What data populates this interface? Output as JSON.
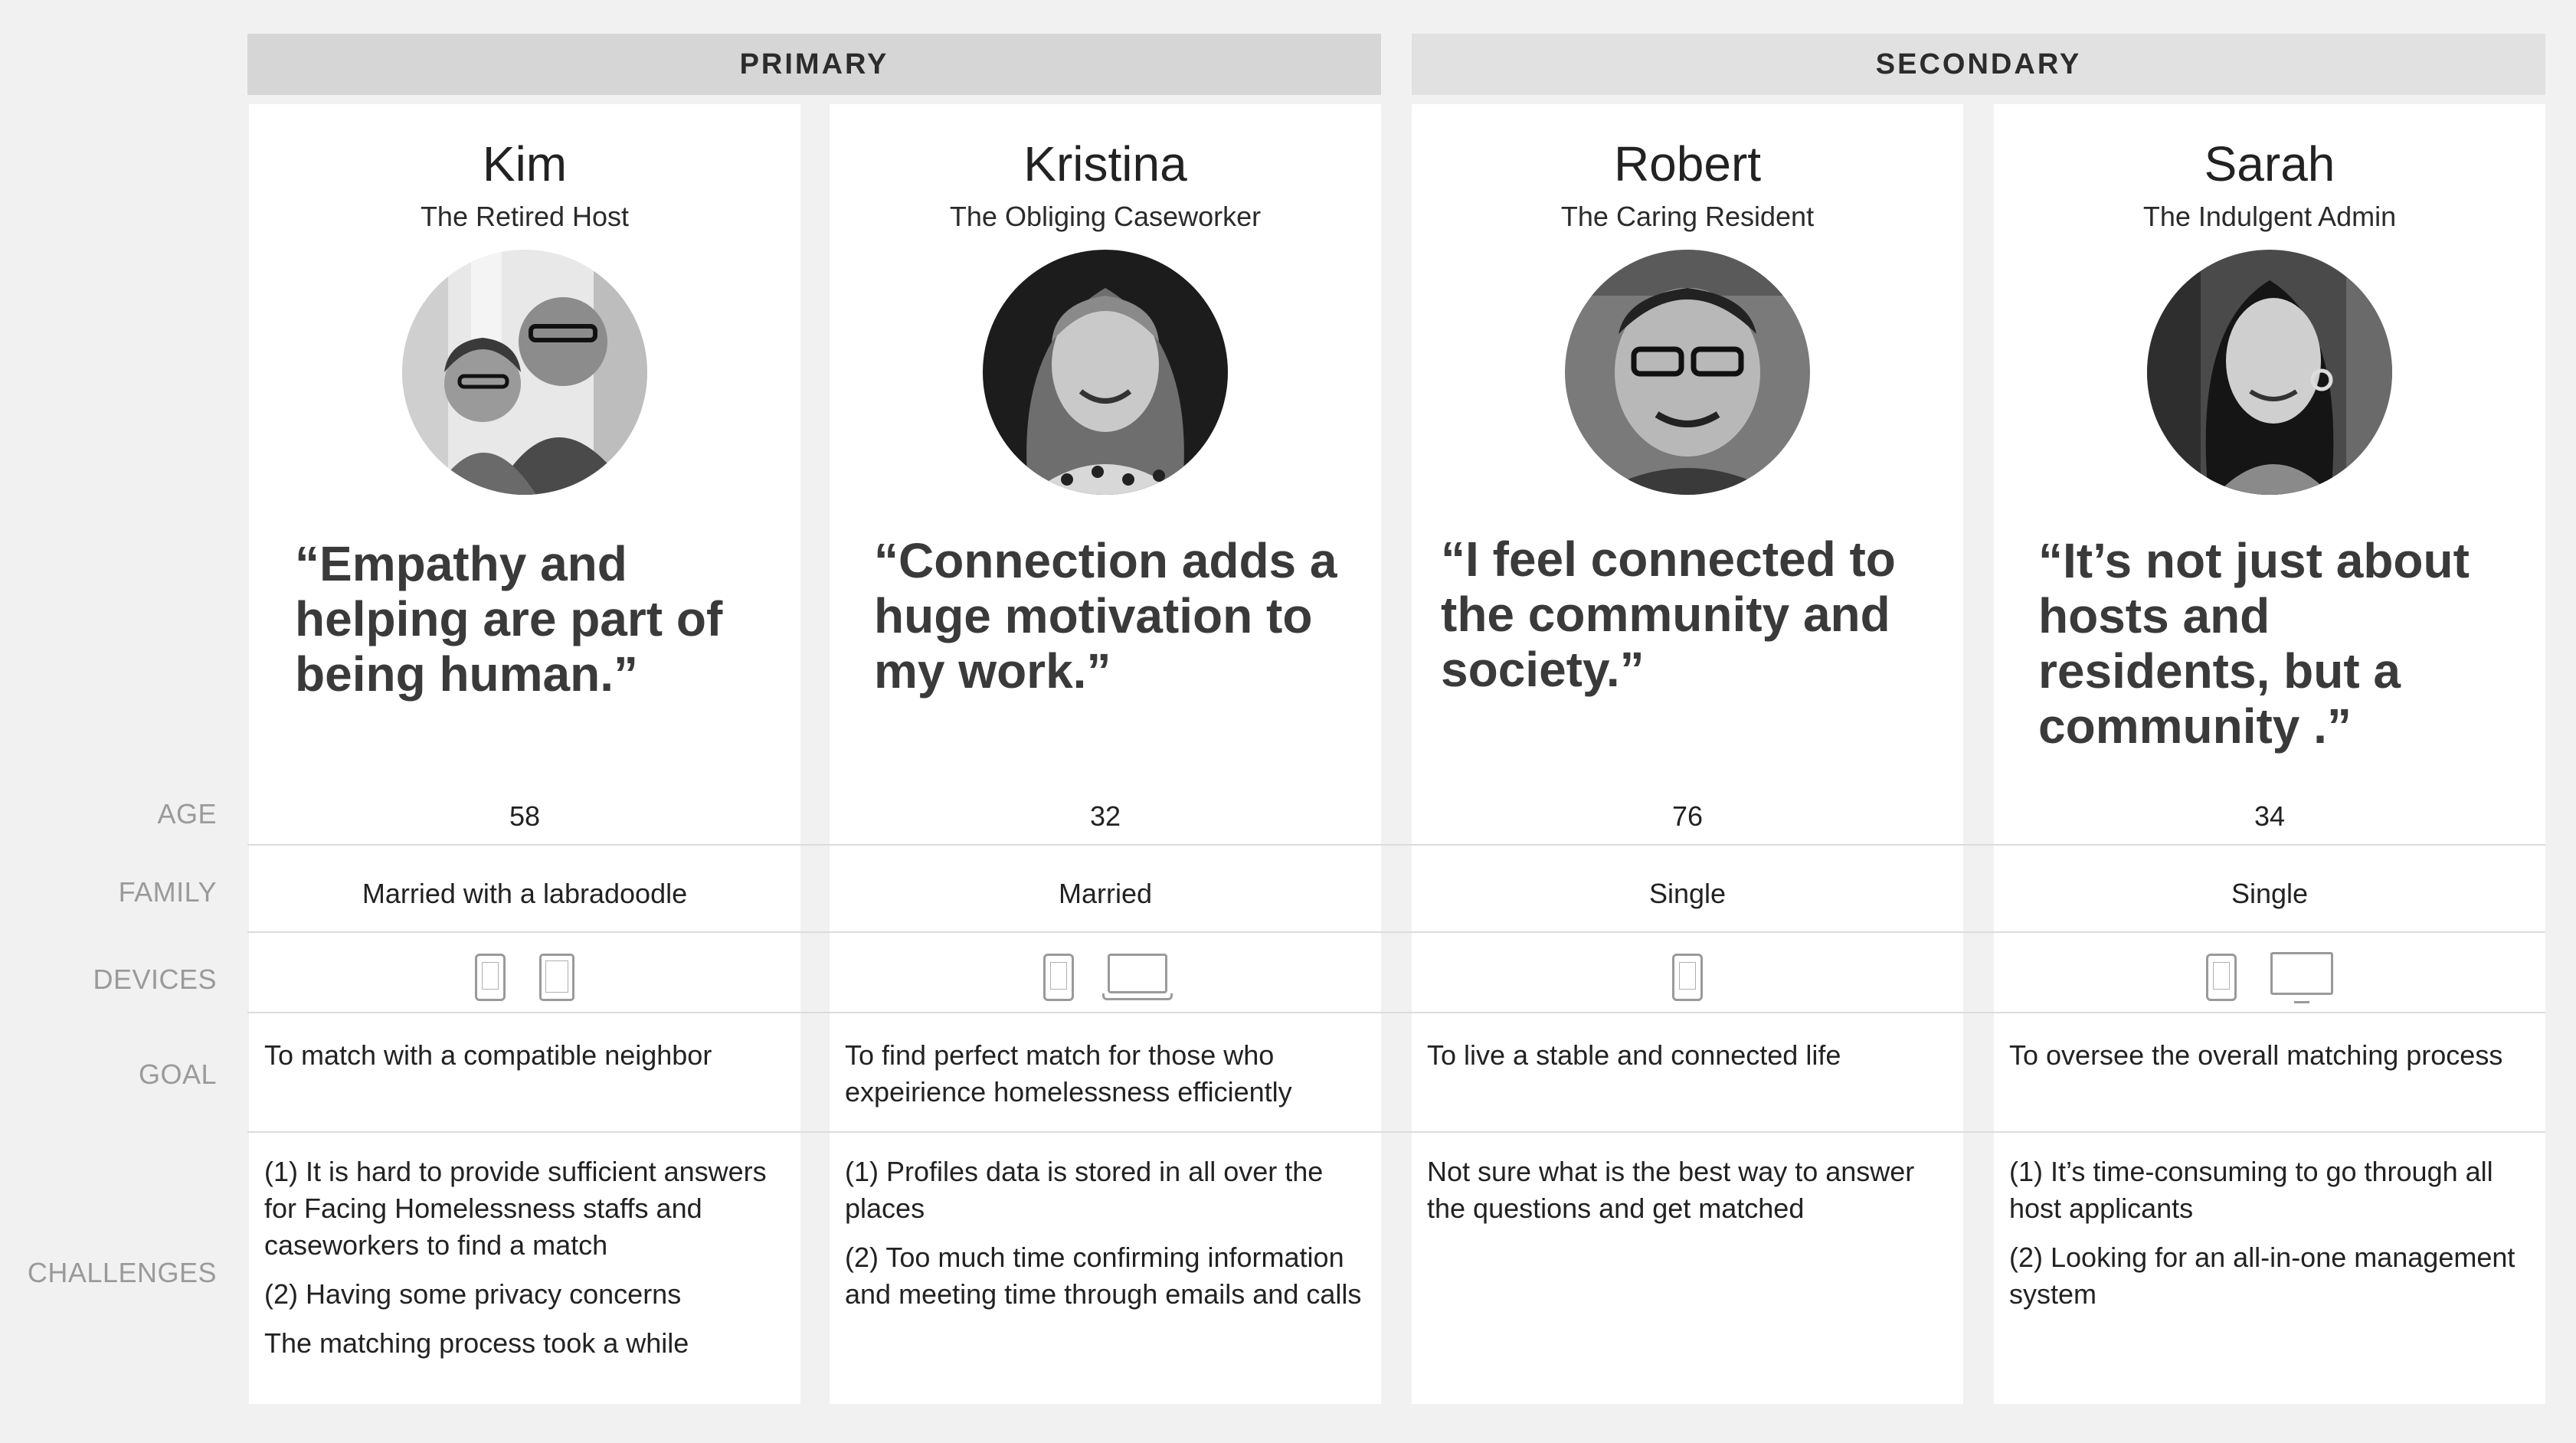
{
  "groups": {
    "primary": "PRIMARY",
    "secondary": "SECONDARY"
  },
  "row_labels": {
    "age": "AGE",
    "family": "FAMILY",
    "devices": "DEVICES",
    "goal": "GOAL",
    "challenges": "CHALLENGES"
  },
  "personas": [
    {
      "name": "Kim",
      "role": "The Retired Host",
      "quote": "“Empathy and helping are part of being human.”",
      "age": "58",
      "family": "Married with a labradoodle",
      "devices": [
        "phone-icon",
        "tablet-icon"
      ],
      "goal": "To match with a compatible neighbor",
      "challenges": [
        "(1) It is hard to provide sufficient answers for Facing Homelessness staffs and caseworkers to find a match",
        "(2) Having some privacy concerns",
        "The matching process took a while"
      ]
    },
    {
      "name": "Kristina",
      "role": "The Obliging Caseworker",
      "quote": "“Connection adds a huge motivation to my work.”",
      "age": "32",
      "family": "Married",
      "devices": [
        "phone-icon",
        "laptop-icon"
      ],
      "goal": "To find perfect match for those who expeirience homelessness efficiently",
      "challenges": [
        "(1) Profiles data is stored in all over the places",
        "(2) Too much time confirming information and meeting time through emails and calls"
      ]
    },
    {
      "name": "Robert",
      "role": "The Caring Resident",
      "quote": "“I feel connected to the community and society.”",
      "age": "76",
      "family": "Single",
      "devices": [
        "phone-icon"
      ],
      "goal": "To live a stable and connected life",
      "challenges": [
        "Not sure what is the best way to answer the questions and get matched"
      ]
    },
    {
      "name": "Sarah",
      "role": "The Indulgent Admin",
      "quote": "“It’s not just about hosts and residents, but a community .”",
      "age": "34",
      "family": "Single",
      "devices": [
        "phone-icon",
        "monitor-icon"
      ],
      "goal": "To oversee the overall matching process",
      "challenges": [
        "(1) It’s time-consuming to go through all host applicants",
        "(2) Looking for an all-in-one management system"
      ]
    }
  ]
}
